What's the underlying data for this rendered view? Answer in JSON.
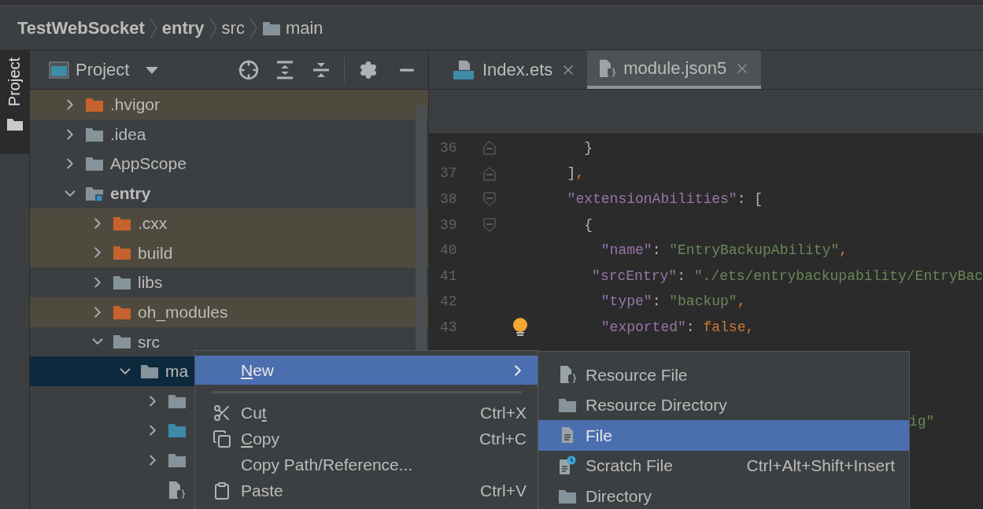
{
  "breadcrumb": [
    {
      "label": "TestWebSocket",
      "kind": "project"
    },
    {
      "label": "entry",
      "kind": "module"
    },
    {
      "label": "src",
      "kind": "plain"
    },
    {
      "label": "main",
      "kind": "folder"
    }
  ],
  "tool_strip": {
    "label": "Project",
    "selected": true
  },
  "project_panel": {
    "title": "Project"
  },
  "tree": [
    {
      "name": ".hvigor",
      "kind": "excluded",
      "expanded": false,
      "selected": false
    },
    {
      "name": ".idea",
      "kind": "folder",
      "expanded": false,
      "selected": false
    },
    {
      "name": "AppScope",
      "kind": "folder",
      "expanded": false,
      "selected": false
    },
    {
      "name": "entry",
      "kind": "module",
      "expanded": true,
      "selected": false,
      "children": [
        {
          "name": ".cxx",
          "kind": "excluded",
          "expanded": false,
          "selected": false
        },
        {
          "name": "build",
          "kind": "excluded",
          "expanded": false,
          "selected": false
        },
        {
          "name": "libs",
          "kind": "folder",
          "expanded": false,
          "selected": false
        },
        {
          "name": "oh_modules",
          "kind": "excluded",
          "expanded": false,
          "selected": false
        },
        {
          "name": "src",
          "kind": "folder",
          "expanded": true,
          "selected": false,
          "children": [
            {
              "name": "ma",
              "kind": "folder",
              "expanded": true,
              "selected": true,
              "children": [
                {
                  "kind": "folder",
                  "expanded": false,
                  "selected": false
                },
                {
                  "kind": "source",
                  "expanded": false,
                  "selected": false
                },
                {
                  "kind": "folder",
                  "expanded": false,
                  "selected": false
                },
                {
                  "kind": "file",
                  "selected": false
                }
              ]
            }
          ]
        }
      ]
    }
  ],
  "tabs": [
    {
      "label": "Index.ets",
      "kind": "ets",
      "selected": false
    },
    {
      "label": "module.json5",
      "kind": "json",
      "selected": true
    }
  ],
  "code": [
    {
      "num": "36",
      "fold_end": true,
      "tokens": [
        {
          "t": "    }",
          "kind": "punct"
        }
      ]
    },
    {
      "num": "37",
      "fold_end": true,
      "tokens": [
        {
          "t": "  ]",
          "kind": "punct"
        },
        {
          "t": ",",
          "kind": "keyword"
        }
      ]
    },
    {
      "num": "38",
      "fold_start": true,
      "tokens": [
        {
          "t": "  \"extensionAbilities\"",
          "kind": "key"
        },
        {
          "t": ": [",
          "kind": "punct"
        }
      ]
    },
    {
      "num": "39",
      "fold_start": true,
      "tokens": [
        {
          "t": "    {",
          "kind": "punct"
        }
      ]
    },
    {
      "num": "40",
      "tokens": [
        {
          "t": "      \"name\"",
          "kind": "key"
        },
        {
          "t": ": ",
          "kind": "punct"
        },
        {
          "t": "\"EntryBackupAbility\"",
          "kind": "string"
        },
        {
          "t": ",",
          "kind": "keyword"
        }
      ]
    },
    {
      "num": "41",
      "tokens": [
        {
          "t": "      \"srcEntry\"",
          "kind": "key"
        },
        {
          "t": ": ",
          "kind": "punct"
        },
        {
          "t": "\"./ets/entrybackupability/EntryBac",
          "kind": "string"
        }
      ]
    },
    {
      "num": "42",
      "tokens": [
        {
          "t": "      \"type\"",
          "kind": "key"
        },
        {
          "t": ": ",
          "kind": "punct"
        },
        {
          "t": "\"backup\"",
          "kind": "string"
        },
        {
          "t": ",",
          "kind": "keyword"
        }
      ]
    },
    {
      "num": "43",
      "bulb": true,
      "tokens": [
        {
          "t": "      \"exported\"",
          "kind": "key"
        },
        {
          "t": ": ",
          "kind": "punct"
        },
        {
          "t": "false",
          "kind": "keyword"
        },
        {
          "t": ",",
          "kind": "keyword"
        }
      ]
    }
  ],
  "code_fragment": "ig\"",
  "context_menu": [
    {
      "kind": "submenu",
      "key": "N",
      "post": "ew",
      "selected": true
    },
    {
      "kind": "separator"
    },
    {
      "kind": "cut",
      "pre": "Cu",
      "key": "t",
      "shortcut": "Ctrl+X",
      "selected": false
    },
    {
      "kind": "copy",
      "key": "C",
      "post": "opy",
      "shortcut": "Ctrl+C",
      "selected": false
    },
    {
      "kind": "plain",
      "pre": "Copy Path/Reference...",
      "selected": false
    },
    {
      "kind": "paste",
      "pre": "Paste",
      "shortcut": "Ctrl+V",
      "selected": false
    }
  ],
  "submenu": [
    {
      "label": "Resource File",
      "kind": "resource",
      "selected": false
    },
    {
      "label": "Resource Directory",
      "kind": "folder",
      "selected": false
    },
    {
      "label": "File",
      "kind": "file",
      "selected": true
    },
    {
      "label": "Scratch File",
      "kind": "scratch",
      "shortcut": "Ctrl+Alt+Shift+Insert",
      "selected": false
    },
    {
      "label": "Directory",
      "kind": "folder",
      "selected": false
    }
  ]
}
